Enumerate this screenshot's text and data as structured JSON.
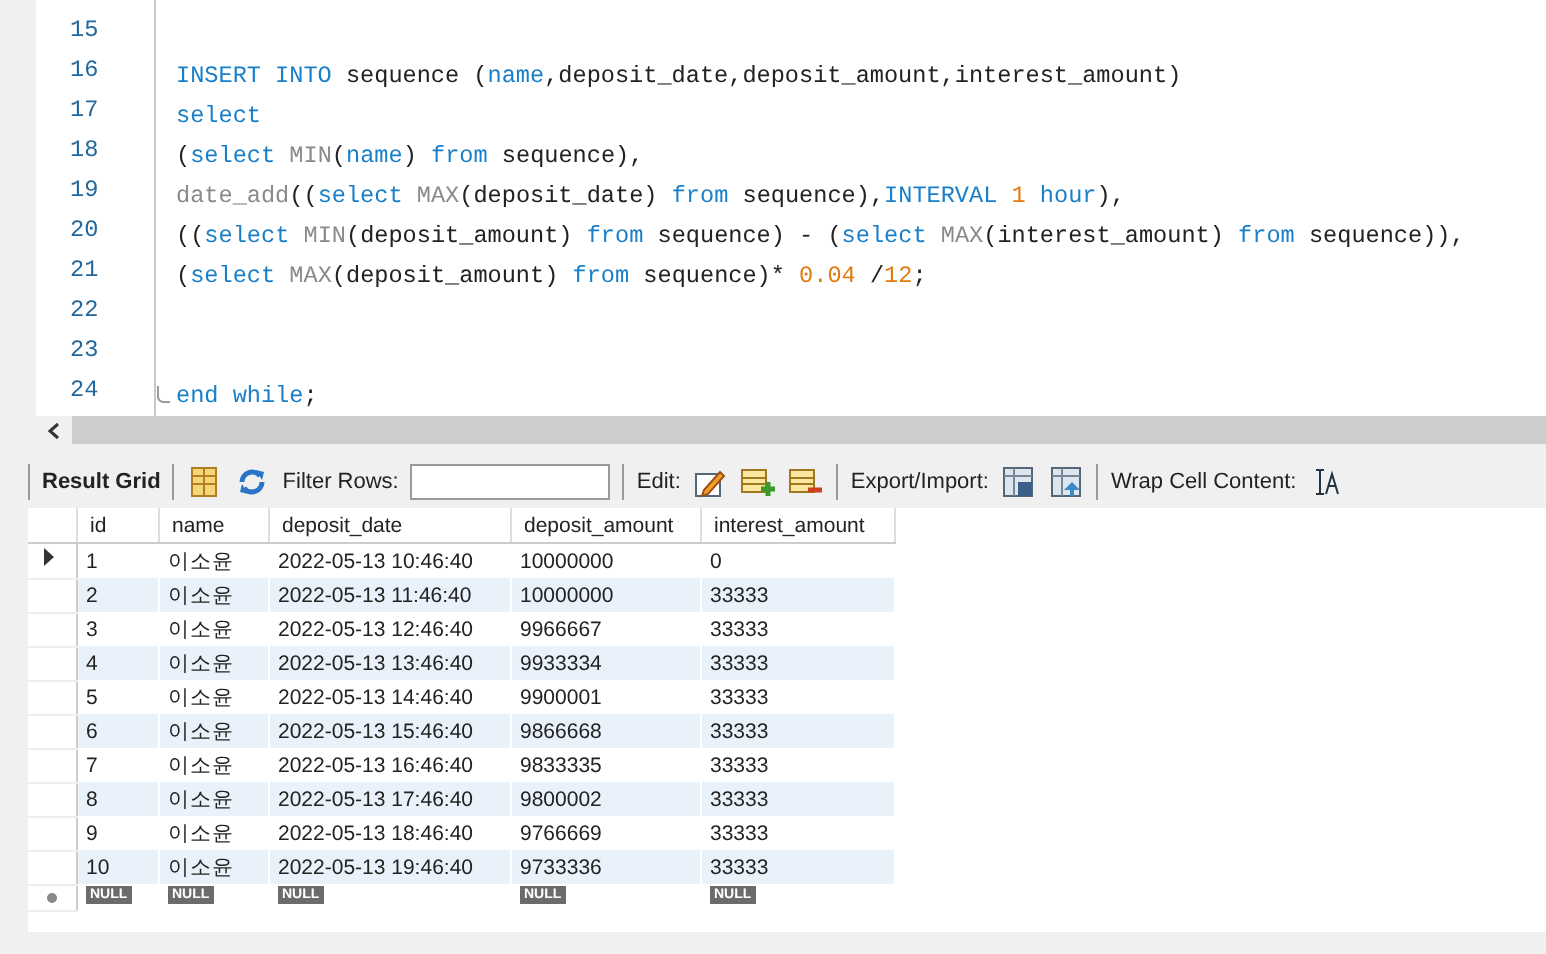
{
  "editor": {
    "lines": [
      {
        "number": "15",
        "fold": false
      },
      {
        "number": "16",
        "fold": false,
        "tokens": [
          {
            "kind": "keyword",
            "text": "INSERT INTO"
          },
          {
            "kind": "plain",
            "text": " sequence ("
          },
          {
            "kind": "keyword",
            "text": "name"
          },
          {
            "kind": "plain",
            "text": ",deposit_date,deposit_amount,interest_amount)"
          }
        ]
      },
      {
        "number": "17",
        "fold": false,
        "tokens": [
          {
            "kind": "keyword",
            "text": "select"
          }
        ]
      },
      {
        "number": "18",
        "fold": false,
        "tokens": [
          {
            "kind": "plain",
            "text": "("
          },
          {
            "kind": "keyword",
            "text": "select "
          },
          {
            "kind": "function",
            "text": "MIN"
          },
          {
            "kind": "plain",
            "text": "("
          },
          {
            "kind": "keyword",
            "text": "name"
          },
          {
            "kind": "plain",
            "text": ") "
          },
          {
            "kind": "keyword",
            "text": "from"
          },
          {
            "kind": "plain",
            "text": " sequence),"
          }
        ]
      },
      {
        "number": "19",
        "fold": false,
        "tokens": [
          {
            "kind": "function",
            "text": "date_add"
          },
          {
            "kind": "plain",
            "text": "(("
          },
          {
            "kind": "keyword",
            "text": "select "
          },
          {
            "kind": "function",
            "text": "MAX"
          },
          {
            "kind": "plain",
            "text": "(deposit_date) "
          },
          {
            "kind": "keyword",
            "text": "from"
          },
          {
            "kind": "plain",
            "text": " sequence),"
          },
          {
            "kind": "keyword",
            "text": "INTERVAL "
          },
          {
            "kind": "number",
            "text": "1 "
          },
          {
            "kind": "keyword",
            "text": "hour"
          },
          {
            "kind": "plain",
            "text": "),"
          }
        ]
      },
      {
        "number": "20",
        "fold": false,
        "tokens": [
          {
            "kind": "plain",
            "text": "(("
          },
          {
            "kind": "keyword",
            "text": "select "
          },
          {
            "kind": "function",
            "text": "MIN"
          },
          {
            "kind": "plain",
            "text": "(deposit_amount) "
          },
          {
            "kind": "keyword",
            "text": "from"
          },
          {
            "kind": "plain",
            "text": " sequence) - ("
          },
          {
            "kind": "keyword",
            "text": "select "
          },
          {
            "kind": "function",
            "text": "MAX"
          },
          {
            "kind": "plain",
            "text": "(interest_amount) "
          },
          {
            "kind": "keyword",
            "text": "from"
          },
          {
            "kind": "plain",
            "text": " sequence)),"
          }
        ]
      },
      {
        "number": "21",
        "fold": false,
        "tokens": [
          {
            "kind": "plain",
            "text": "("
          },
          {
            "kind": "keyword",
            "text": "select "
          },
          {
            "kind": "function",
            "text": "MAX"
          },
          {
            "kind": "plain",
            "text": "(deposit_amount) "
          },
          {
            "kind": "keyword",
            "text": "from"
          },
          {
            "kind": "plain",
            "text": " sequence)* "
          },
          {
            "kind": "number",
            "text": "0.04"
          },
          {
            "kind": "plain",
            "text": " /"
          },
          {
            "kind": "number",
            "text": "12"
          },
          {
            "kind": "plain",
            "text": ";"
          }
        ]
      },
      {
        "number": "22",
        "fold": false
      },
      {
        "number": "23",
        "fold": false
      },
      {
        "number": "24",
        "fold": true,
        "tokens": [
          {
            "kind": "keyword",
            "text": "end while"
          },
          {
            "kind": "plain",
            "text": ";"
          }
        ]
      }
    ]
  },
  "toolbar": {
    "result_tab": "Result Grid",
    "filter_label": "Filter Rows:",
    "edit_label": "Edit:",
    "export_label": "Export/Import:",
    "wrap_label": "Wrap Cell Content:"
  },
  "table": {
    "columns": [
      "id",
      "name",
      "deposit_date",
      "deposit_amount",
      "interest_amount"
    ],
    "rows": [
      {
        "current": true,
        "cells": [
          "1",
          "이소윤",
          "2022-05-13 10:46:40",
          "10000000",
          "0"
        ]
      },
      {
        "current": false,
        "cells": [
          "2",
          "이소윤",
          "2022-05-13 11:46:40",
          "10000000",
          "33333"
        ]
      },
      {
        "current": false,
        "cells": [
          "3",
          "이소윤",
          "2022-05-13 12:46:40",
          "9966667",
          "33333"
        ]
      },
      {
        "current": false,
        "cells": [
          "4",
          "이소윤",
          "2022-05-13 13:46:40",
          "9933334",
          "33333"
        ]
      },
      {
        "current": false,
        "cells": [
          "5",
          "이소윤",
          "2022-05-13 14:46:40",
          "9900001",
          "33333"
        ]
      },
      {
        "current": false,
        "cells": [
          "6",
          "이소윤",
          "2022-05-13 15:46:40",
          "9866668",
          "33333"
        ]
      },
      {
        "current": false,
        "cells": [
          "7",
          "이소윤",
          "2022-05-13 16:46:40",
          "9833335",
          "33333"
        ]
      },
      {
        "current": false,
        "cells": [
          "8",
          "이소윤",
          "2022-05-13 17:46:40",
          "9800002",
          "33333"
        ]
      },
      {
        "current": false,
        "cells": [
          "9",
          "이소윤",
          "2022-05-13 18:46:40",
          "9766669",
          "33333"
        ]
      },
      {
        "current": false,
        "cells": [
          "10",
          "이소윤",
          "2022-05-13 19:46:40",
          "9733336",
          "33333"
        ]
      }
    ],
    "new_row": [
      "NULL",
      "NULL",
      "NULL",
      "NULL",
      "NULL"
    ]
  }
}
